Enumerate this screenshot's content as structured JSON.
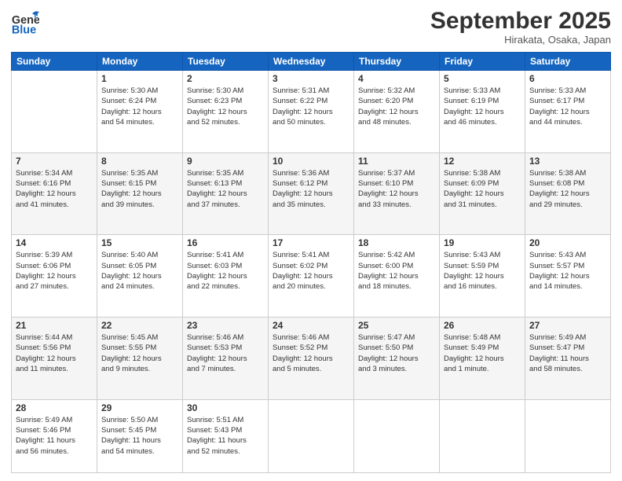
{
  "header": {
    "logo_line1": "General",
    "logo_line2": "Blue",
    "month": "September 2025",
    "location": "Hirakata, Osaka, Japan"
  },
  "weekdays": [
    "Sunday",
    "Monday",
    "Tuesday",
    "Wednesday",
    "Thursday",
    "Friday",
    "Saturday"
  ],
  "weeks": [
    [
      {
        "day": "",
        "text": ""
      },
      {
        "day": "1",
        "text": "Sunrise: 5:30 AM\nSunset: 6:24 PM\nDaylight: 12 hours\nand 54 minutes."
      },
      {
        "day": "2",
        "text": "Sunrise: 5:30 AM\nSunset: 6:23 PM\nDaylight: 12 hours\nand 52 minutes."
      },
      {
        "day": "3",
        "text": "Sunrise: 5:31 AM\nSunset: 6:22 PM\nDaylight: 12 hours\nand 50 minutes."
      },
      {
        "day": "4",
        "text": "Sunrise: 5:32 AM\nSunset: 6:20 PM\nDaylight: 12 hours\nand 48 minutes."
      },
      {
        "day": "5",
        "text": "Sunrise: 5:33 AM\nSunset: 6:19 PM\nDaylight: 12 hours\nand 46 minutes."
      },
      {
        "day": "6",
        "text": "Sunrise: 5:33 AM\nSunset: 6:17 PM\nDaylight: 12 hours\nand 44 minutes."
      }
    ],
    [
      {
        "day": "7",
        "text": "Sunrise: 5:34 AM\nSunset: 6:16 PM\nDaylight: 12 hours\nand 41 minutes."
      },
      {
        "day": "8",
        "text": "Sunrise: 5:35 AM\nSunset: 6:15 PM\nDaylight: 12 hours\nand 39 minutes."
      },
      {
        "day": "9",
        "text": "Sunrise: 5:35 AM\nSunset: 6:13 PM\nDaylight: 12 hours\nand 37 minutes."
      },
      {
        "day": "10",
        "text": "Sunrise: 5:36 AM\nSunset: 6:12 PM\nDaylight: 12 hours\nand 35 minutes."
      },
      {
        "day": "11",
        "text": "Sunrise: 5:37 AM\nSunset: 6:10 PM\nDaylight: 12 hours\nand 33 minutes."
      },
      {
        "day": "12",
        "text": "Sunrise: 5:38 AM\nSunset: 6:09 PM\nDaylight: 12 hours\nand 31 minutes."
      },
      {
        "day": "13",
        "text": "Sunrise: 5:38 AM\nSunset: 6:08 PM\nDaylight: 12 hours\nand 29 minutes."
      }
    ],
    [
      {
        "day": "14",
        "text": "Sunrise: 5:39 AM\nSunset: 6:06 PM\nDaylight: 12 hours\nand 27 minutes."
      },
      {
        "day": "15",
        "text": "Sunrise: 5:40 AM\nSunset: 6:05 PM\nDaylight: 12 hours\nand 24 minutes."
      },
      {
        "day": "16",
        "text": "Sunrise: 5:41 AM\nSunset: 6:03 PM\nDaylight: 12 hours\nand 22 minutes."
      },
      {
        "day": "17",
        "text": "Sunrise: 5:41 AM\nSunset: 6:02 PM\nDaylight: 12 hours\nand 20 minutes."
      },
      {
        "day": "18",
        "text": "Sunrise: 5:42 AM\nSunset: 6:00 PM\nDaylight: 12 hours\nand 18 minutes."
      },
      {
        "day": "19",
        "text": "Sunrise: 5:43 AM\nSunset: 5:59 PM\nDaylight: 12 hours\nand 16 minutes."
      },
      {
        "day": "20",
        "text": "Sunrise: 5:43 AM\nSunset: 5:57 PM\nDaylight: 12 hours\nand 14 minutes."
      }
    ],
    [
      {
        "day": "21",
        "text": "Sunrise: 5:44 AM\nSunset: 5:56 PM\nDaylight: 12 hours\nand 11 minutes."
      },
      {
        "day": "22",
        "text": "Sunrise: 5:45 AM\nSunset: 5:55 PM\nDaylight: 12 hours\nand 9 minutes."
      },
      {
        "day": "23",
        "text": "Sunrise: 5:46 AM\nSunset: 5:53 PM\nDaylight: 12 hours\nand 7 minutes."
      },
      {
        "day": "24",
        "text": "Sunrise: 5:46 AM\nSunset: 5:52 PM\nDaylight: 12 hours\nand 5 minutes."
      },
      {
        "day": "25",
        "text": "Sunrise: 5:47 AM\nSunset: 5:50 PM\nDaylight: 12 hours\nand 3 minutes."
      },
      {
        "day": "26",
        "text": "Sunrise: 5:48 AM\nSunset: 5:49 PM\nDaylight: 12 hours\nand 1 minute."
      },
      {
        "day": "27",
        "text": "Sunrise: 5:49 AM\nSunset: 5:47 PM\nDaylight: 11 hours\nand 58 minutes."
      }
    ],
    [
      {
        "day": "28",
        "text": "Sunrise: 5:49 AM\nSunset: 5:46 PM\nDaylight: 11 hours\nand 56 minutes."
      },
      {
        "day": "29",
        "text": "Sunrise: 5:50 AM\nSunset: 5:45 PM\nDaylight: 11 hours\nand 54 minutes."
      },
      {
        "day": "30",
        "text": "Sunrise: 5:51 AM\nSunset: 5:43 PM\nDaylight: 11 hours\nand 52 minutes."
      },
      {
        "day": "",
        "text": ""
      },
      {
        "day": "",
        "text": ""
      },
      {
        "day": "",
        "text": ""
      },
      {
        "day": "",
        "text": ""
      }
    ]
  ]
}
